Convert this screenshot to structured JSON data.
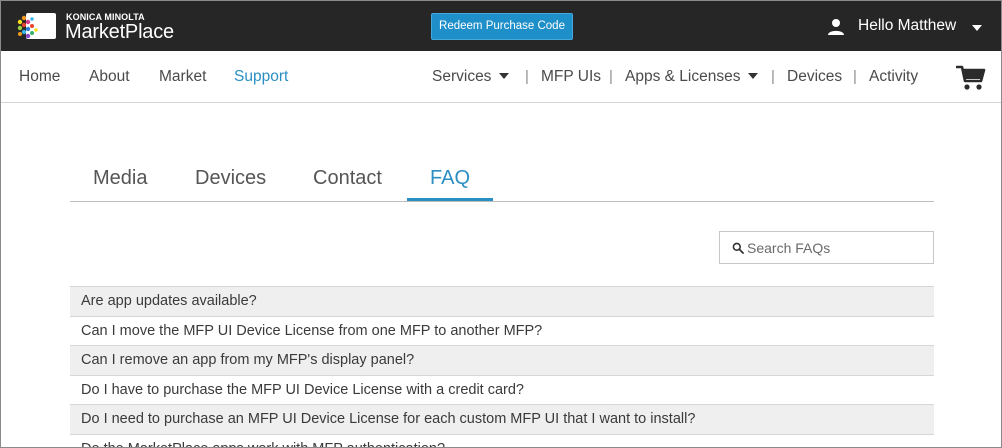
{
  "header": {
    "logo_brand": "KONICA MINOLTA",
    "logo_product": "MarketPlace",
    "redeem_label": "Redeem Purchase Code",
    "user_greeting": "Hello Matthew"
  },
  "nav": {
    "left": [
      "Home",
      "About",
      "Market",
      "Support"
    ],
    "active": "Support",
    "right": [
      "Services",
      "MFP UIs",
      "Apps & Licenses",
      "Devices",
      "Activity"
    ],
    "separator": "|"
  },
  "tabs": {
    "items": [
      "Media",
      "Devices",
      "Contact",
      "FAQ"
    ],
    "active": "FAQ"
  },
  "search": {
    "placeholder": "Search FAQs",
    "value": ""
  },
  "faq": {
    "items": [
      "Are app updates available?",
      "Can I move the MFP UI Device License from one MFP to another MFP?",
      "Can I remove an app from my MFP's display panel?",
      "Do I have to purchase the MFP UI Device License with a credit card?",
      "Do I need to purchase an MFP UI Device License for each custom MFP UI that I want to install?",
      "Do the MarketPlace apps work with MFP authentication?"
    ]
  },
  "colors": {
    "topbar": "#262626",
    "accent": "#2a8fc3",
    "button": "#1f8fc9",
    "row_shade": "#efefef"
  },
  "icons": {
    "user": "user-icon",
    "cart": "cart-icon",
    "search": "search-icon",
    "caret": "caret-down-icon"
  }
}
